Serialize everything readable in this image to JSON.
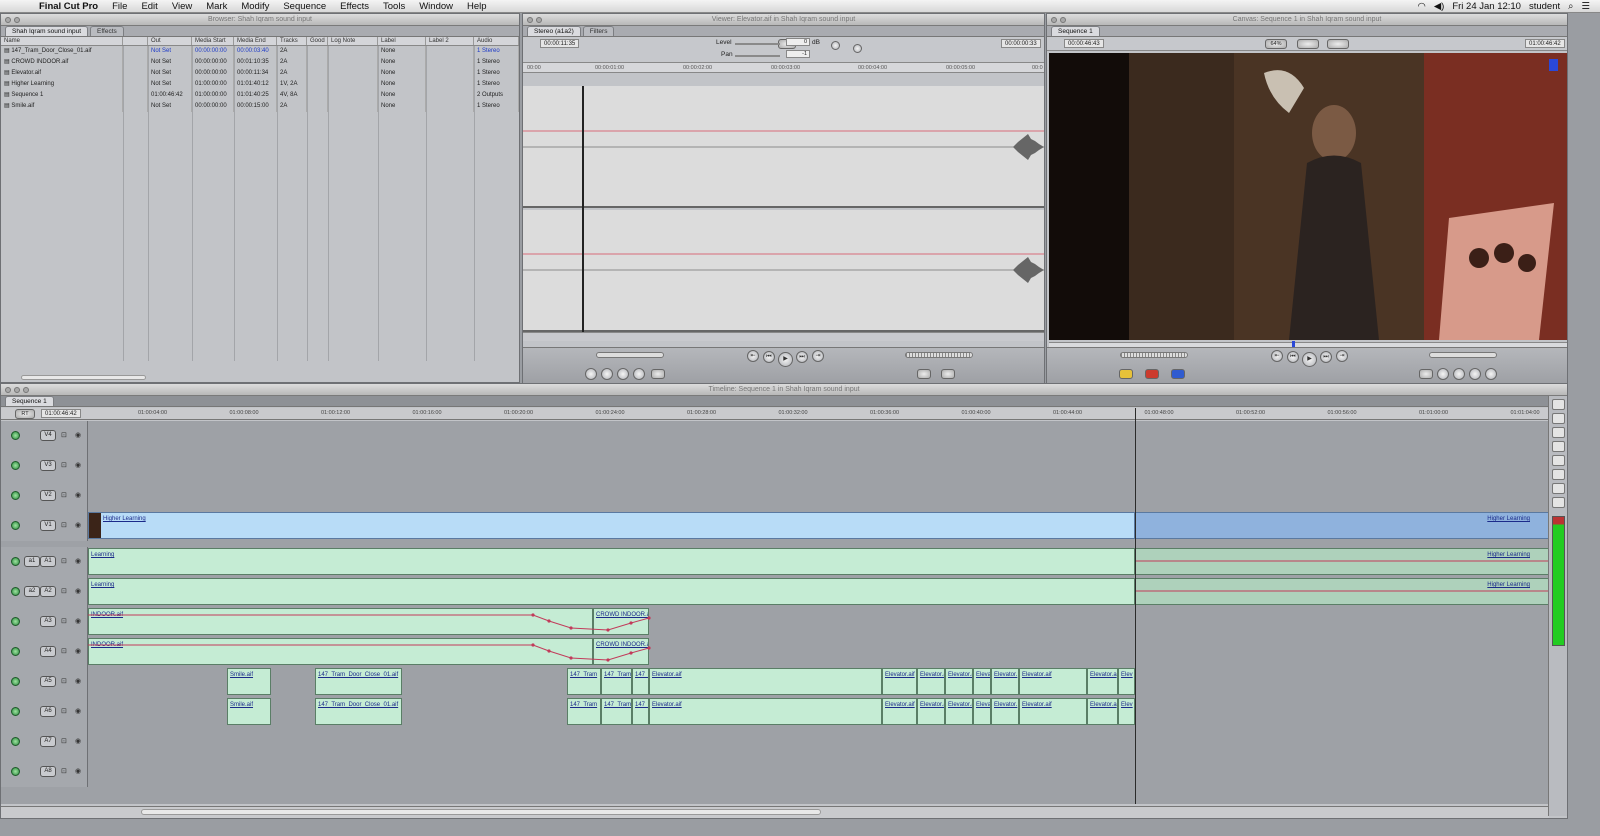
{
  "menubar": {
    "app": "Final Cut Pro",
    "items": [
      "File",
      "Edit",
      "View",
      "Mark",
      "Modify",
      "Sequence",
      "Effects",
      "Tools",
      "Window",
      "Help"
    ],
    "clock": "Fri 24 Jan  12:10",
    "user": "student"
  },
  "browser": {
    "title": "Browser: Shah Iqram sound input",
    "tabs": [
      "Shah Iqram sound input",
      "Effects"
    ],
    "columns": [
      "Name",
      "Out",
      "Media Start",
      "Media End",
      "Tracks",
      "Good",
      "Log Note",
      "Label",
      "Label 2",
      "Audio"
    ],
    "rows": [
      {
        "name": "147_Tram_Door_Close_01.aif",
        "out": "Not Set",
        "start": "00:00:00:00",
        "end": "00:00:03:40",
        "tracks": "2A",
        "label": "None",
        "audio": "1 Stereo"
      },
      {
        "name": "CROWD INDOOR.aif",
        "out": "Not Set",
        "start": "00:00:00:00",
        "end": "00:01:10:35",
        "tracks": "2A",
        "label": "None",
        "audio": "1 Stereo"
      },
      {
        "name": "Elevator.aif",
        "out": "Not Set",
        "start": "00:00:00:00",
        "end": "00:00:11:34",
        "tracks": "2A",
        "label": "None",
        "audio": "1 Stereo"
      },
      {
        "name": "Higher Learning",
        "out": "Not Set",
        "start": "01:00:00:00",
        "end": "01:01:40:12",
        "tracks": "1V, 2A",
        "label": "None",
        "audio": "1 Stereo"
      },
      {
        "name": "Sequence 1",
        "out": "01:00:46:42",
        "start": "01:00:00:00",
        "end": "01:01:40:25",
        "tracks": "4V, 8A",
        "label": "None",
        "audio": "2 Outputs"
      },
      {
        "name": "Smile.aif",
        "out": "Not Set",
        "start": "00:00:00:00",
        "end": "00:00:15:00",
        "tracks": "2A",
        "label": "None",
        "audio": "1 Stereo"
      }
    ]
  },
  "viewer": {
    "title": "Viewer: Elevator.aif in Shah Iqram sound input",
    "tabs": [
      "Stereo (a1a2)",
      "Filters"
    ],
    "timecode_left": "00:00:11:35",
    "timecode_right": "00:00:00:33",
    "level_label": "Level",
    "level_value": "0",
    "level_unit": "dB",
    "pan_label": "Pan",
    "pan_value": "-1",
    "ruler": [
      "00:00",
      "00:00:01:00",
      "00:00:02:00",
      "00:00:03:00",
      "00:00:04:00",
      "00:00:05:00",
      "00:0"
    ]
  },
  "canvas": {
    "title": "Canvas: Sequence 1 in Shah Iqram sound input",
    "tab": "Sequence 1",
    "timecode_left": "00:00:46:43",
    "zoom": "64%",
    "timecode_right": "01:00:46:42"
  },
  "timeline": {
    "title": "Timeline: Sequence 1 in Shah Iqram sound input",
    "tab": "Sequence 1",
    "rt": "RT",
    "timecode": "01:00:46:42",
    "ruler": [
      "01:00:04:00",
      "01:00:08:00",
      "01:00:12:00",
      "01:00:16:00",
      "01:00:20:00",
      "01:00:24:00",
      "01:00:28:00",
      "01:00:32:00",
      "01:00:36:00",
      "01:00:40:00",
      "01:00:44:00",
      "01:00:48:00",
      "01:00:52:00",
      "01:00:56:00",
      "01:01:00:00",
      "01:01:04:00"
    ],
    "tracks": [
      "V4",
      "V3",
      "V2",
      "V1",
      "A1",
      "A2",
      "A3",
      "A4",
      "A5",
      "A6",
      "A7",
      "A8"
    ],
    "sources": {
      "a1": "a1",
      "a2": "a2"
    },
    "clips": {
      "v1": "Higher Learning",
      "v1_right": "Higher Learning",
      "a1": "Learning",
      "a1_right": "Higher Learning",
      "a2": "Learning",
      "a2_right": "Higher Learning",
      "a3_left": "INDOOR.aif",
      "a3_right": "CROWD INDOOR.aif",
      "a4_left": "INDOOR.aif",
      "a4_right": "CROWD INDOOR.aif",
      "smile": "Smile.aif",
      "tram": "147_Tram_Door_Close_01.aif",
      "tram_short": "147_Tram",
      "tram_tiny": "147_",
      "elevator": "Elevator.aif",
      "elev_a": "Elevator.a",
      "elev_b": "Elevator.",
      "elev_c": "Eleva",
      "elev_d": "Elev"
    }
  }
}
